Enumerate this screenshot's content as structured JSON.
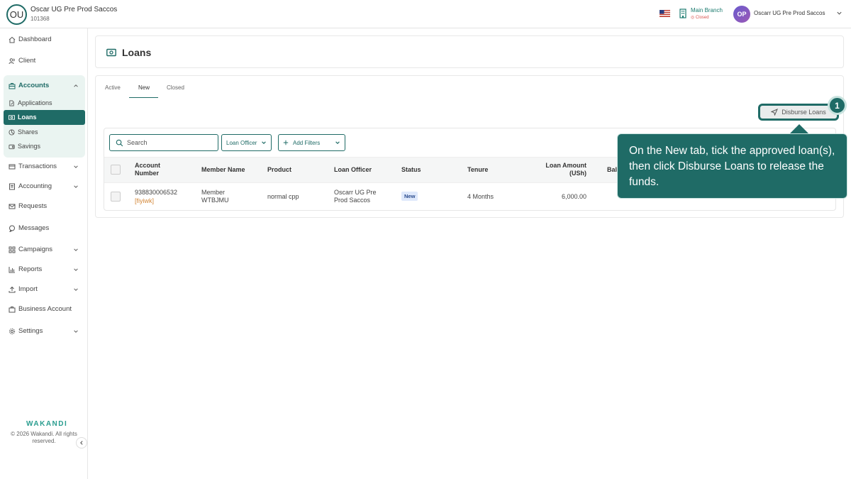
{
  "header": {
    "org_initials": "OU",
    "org_name": "Oscar UG Pre Prod Saccos",
    "org_id": "101368",
    "branch_name": "Main Branch",
    "branch_status": "◎ Closed",
    "user_initials": "OP",
    "user_name": "Oscarr UG Pre Prod Saccos"
  },
  "sidebar": {
    "dashboard": "Dashboard",
    "client": "Client",
    "accounts": "Accounts",
    "applications": "Applications",
    "loans": "Loans",
    "shares": "Shares",
    "savings": "Savings",
    "transactions": "Transactions",
    "accounting": "Accounting",
    "requests": "Requests",
    "messages": "Messages",
    "campaigns": "Campaigns",
    "reports": "Reports",
    "import": "Import",
    "business_account": "Business Account",
    "settings": "Settings",
    "brand": "WAKANDI",
    "copyright": "© 2026 Wakandi. All rights reserved."
  },
  "page": {
    "title": "Loans",
    "tabs": [
      "Active",
      "New",
      "Closed"
    ],
    "disburse_label": "Disburse Loans",
    "step_number": "1"
  },
  "filters": {
    "search_placeholder": "Search",
    "loan_officer": "Loan Officer",
    "add_filters": "Add Filters"
  },
  "table": {
    "columns": {
      "account_number": "Account Number",
      "member_name": "Member Name",
      "product": "Product",
      "loan_officer": "Loan Officer",
      "status": "Status",
      "tenure": "Tenure",
      "loan_amount": "Loan Amount (USh)",
      "balance": "Bal"
    },
    "rows": [
      {
        "account_number": "938830006532",
        "account_code": "[fiyiwk]",
        "member_name": "Member WTBJMU",
        "product": "normal cpp",
        "loan_officer": "Oscarr UG Pre Prod Saccos",
        "status": "New",
        "tenure": "4 Months",
        "loan_amount": "6,000.00"
      }
    ]
  },
  "tooltip": {
    "text": "On the New tab, tick the approved loan(s), then click Disburse Loans to release the funds."
  },
  "colors": {
    "primary": "#1f6b66",
    "accent_text": "#1a7a6e",
    "active_bg": "#eaf4f1",
    "link": "#d4893a"
  }
}
